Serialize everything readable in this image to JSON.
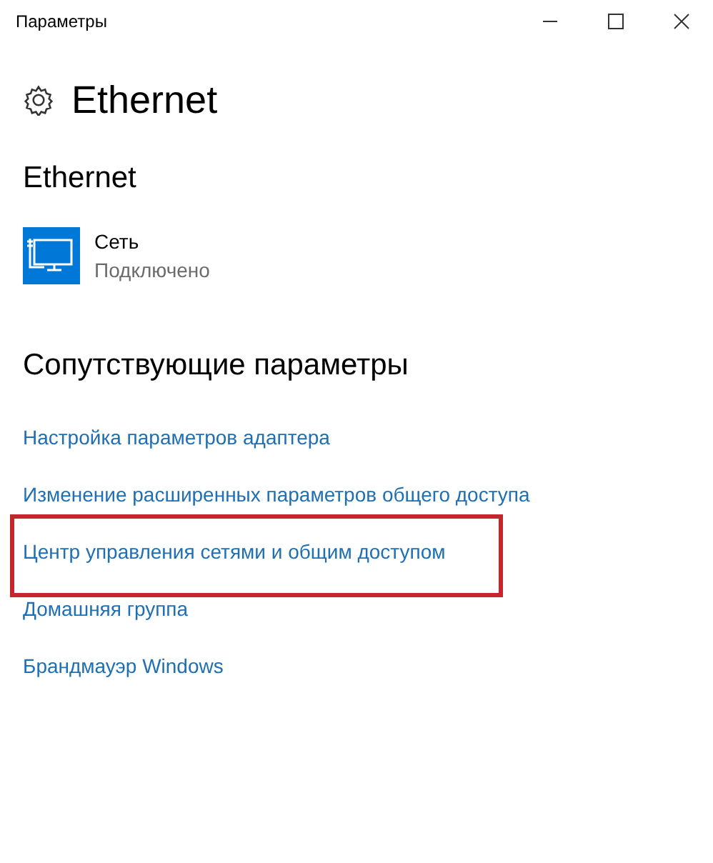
{
  "window": {
    "title": "Параметры"
  },
  "page": {
    "title": "Ethernet"
  },
  "ethernet": {
    "heading": "Ethernet",
    "network": {
      "name": "Сеть",
      "status": "Подключено"
    }
  },
  "related": {
    "heading": "Сопутствующие параметры",
    "links": [
      {
        "label": "Настройка параметров адаптера",
        "highlighted": false
      },
      {
        "label": "Изменение расширенных параметров общего доступа",
        "highlighted": false
      },
      {
        "label": "Центр управления сетями и общим доступом",
        "highlighted": true
      },
      {
        "label": "Домашняя группа",
        "highlighted": false
      },
      {
        "label": "Брандмауэр Windows",
        "highlighted": false
      }
    ]
  }
}
